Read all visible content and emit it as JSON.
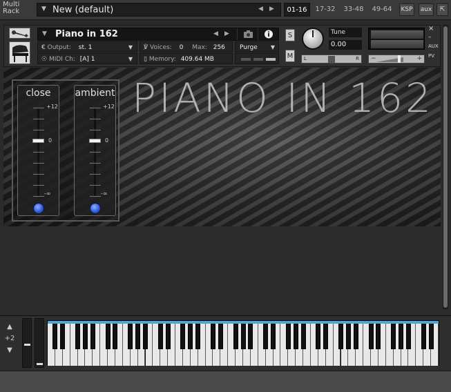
{
  "rack": {
    "label": "Multi\nRack",
    "multi_name": "New (default)",
    "tabs": [
      "01-16",
      "17-32",
      "33-48",
      "49-64"
    ],
    "active_tab": "01-16",
    "ksp": "KSP",
    "aux": "aux"
  },
  "instrument": {
    "name": "Piano in 162",
    "output_label": "Output:",
    "output_value": "st. 1",
    "voices_label": "Voices:",
    "voices_value": "0",
    "max_label": "Max:",
    "max_value": "256",
    "purge": "Purge",
    "midi_label": "MIDI Ch:",
    "midi_value": "[A]  1",
    "memory_label": "Memory:",
    "memory_value": "409.64 MB",
    "solo": "S",
    "mute": "M",
    "tune_label": "Tune",
    "tune_value": "0.00",
    "pan_left": "L",
    "pan_right": "R",
    "vol_minus": "−",
    "vol_plus": "+",
    "aux_small": "AUX",
    "pv_small": "PV"
  },
  "panel": {
    "title": "PIANO IN 162",
    "faders": [
      {
        "label": "close",
        "top": "+12",
        "mid": "0",
        "bottom": "-∞"
      },
      {
        "label": "ambient",
        "top": "+12",
        "mid": "0",
        "bottom": "-∞"
      }
    ]
  },
  "keyboard": {
    "octave_shift": "+2",
    "up_arrow": "▲",
    "down_arrow": "▼"
  }
}
